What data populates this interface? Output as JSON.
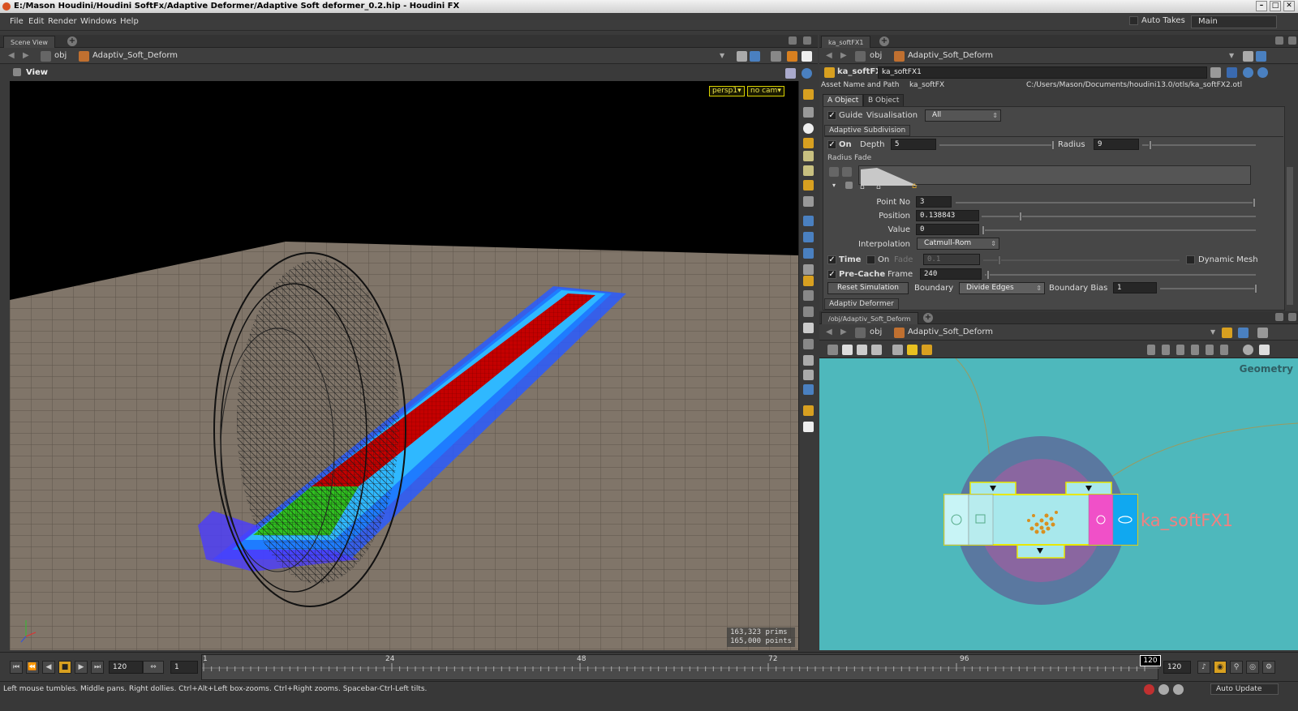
{
  "window": {
    "title": "E:/Mason Houdini/Houdini SoftFx/Adaptive Deformer/Adaptive Soft deformer_0.2.hip - Houdini FX"
  },
  "menu": {
    "items": [
      "File",
      "Edit",
      "Render",
      "Windows",
      "Help"
    ],
    "auto_takes": "Auto Takes",
    "desktop": "Main"
  },
  "scene": {
    "tab": "Scene View",
    "path_root": "obj",
    "path_node": "Adaptiv_Soft_Deform",
    "view_label": "View",
    "camera": "persp1",
    "cam_select": "no cam",
    "stats_prims": "163,323  prims",
    "stats_points": "165,000 points"
  },
  "params": {
    "tab": "ka_softFX1",
    "path_root": "obj",
    "path_node": "Adaptiv_Soft_Deform",
    "op_type": "ka_softFX",
    "node_name": "ka_softFX1",
    "asset_label": "Asset Name and Path",
    "asset_name": "ka_softFX",
    "asset_path": "C:/Users/Mason/Documents/houdini13.0/otls/ka_softFX2.otl",
    "tabs": [
      "A Object",
      "B Object"
    ],
    "guide_label": "Guide",
    "vis_label": "Visualisation",
    "vis_value": "All",
    "adaptive_sub": "Adaptive Subdivision",
    "on_label": "On",
    "depth_label": "Depth",
    "depth_value": "5",
    "radius_label": "Radius",
    "radius_value": "9",
    "radius_fade": "Radius Fade",
    "point_no_label": "Point No",
    "point_no_value": "3",
    "position_label": "Position",
    "position_value": "0.138843",
    "value_label": "Value",
    "value_value": "0",
    "interp_label": "Interpolation",
    "interp_value": "Catmull-Rom",
    "time_label": "Time",
    "time_on": "On",
    "fade_label": "Fade",
    "fade_value": "0.1",
    "dynamic_mesh": "Dynamic Mesh",
    "precache_label": "Pre-Cache",
    "frame_label": "Frame",
    "frame_value": "240",
    "reset_sim": "Reset Simulation",
    "boundary_label": "Boundary",
    "boundary_value": "Divide Edges",
    "boundary_bias_label": "Boundary Bias",
    "boundary_bias_value": "1",
    "adaptiv_deformer": "Adaptiv Deformer"
  },
  "network": {
    "tab": "/obj/Adaptiv_Soft_Deform",
    "path_root": "obj",
    "path_node": "Adaptiv_Soft_Deform",
    "context_label": "Geometry",
    "node_label": "ka_softFX1"
  },
  "timeline": {
    "start": "120",
    "step": "1",
    "ticks": [
      "1",
      "24",
      "48",
      "72",
      "96"
    ],
    "current_frame": "120",
    "end": "120"
  },
  "status": {
    "message": "Left mouse tumbles. Middle pans. Right dollies. Ctrl+Alt+Left box-zooms. Ctrl+Right zooms. Spacebar-Ctrl-Left tilts.",
    "auto_update": "Auto Update"
  },
  "colors": {
    "accent": "#d8a020",
    "network_bg": "#4eb8bc",
    "node_name": "#f28080"
  }
}
